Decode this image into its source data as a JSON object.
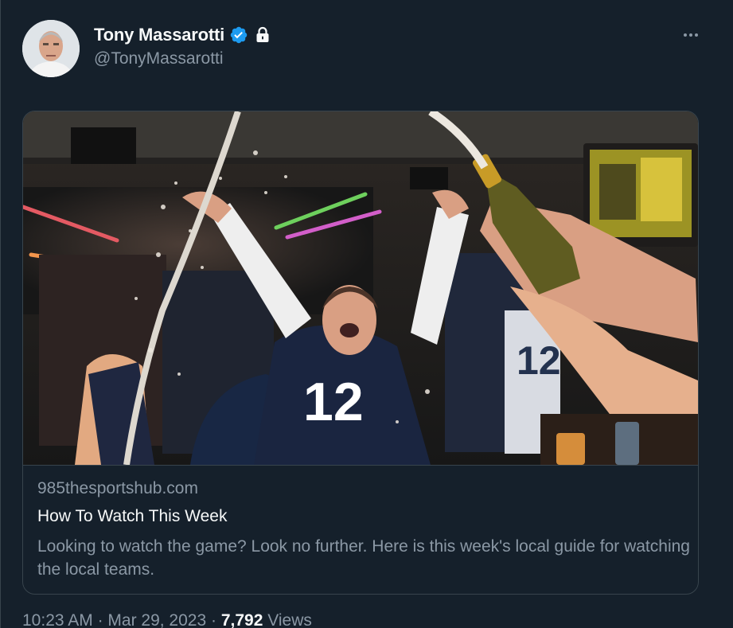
{
  "author": {
    "display_name": "Tony Massarotti",
    "handle": "@TonyMassarotti",
    "verified": true,
    "protected": true,
    "avatar_icon": "avatar-photo"
  },
  "more_menu": {
    "icon": "more-horizontal-icon"
  },
  "card": {
    "domain": "985thesportshub.com",
    "title": "How To Watch This Week",
    "description": "Looking to watch the game? Look no further. Here is this week's local guide for watching the local teams."
  },
  "meta": {
    "time": "10:23 AM",
    "separator1": " · ",
    "date": "Mar 29, 2023",
    "separator2": " · ",
    "views_count": "7,792",
    "views_label": " Views"
  },
  "colors": {
    "background": "#15202b",
    "primary_text": "#f7f9f9",
    "secondary_text": "#8b98a5",
    "border": "#38444d",
    "verified_blue": "#1d9bf0"
  }
}
